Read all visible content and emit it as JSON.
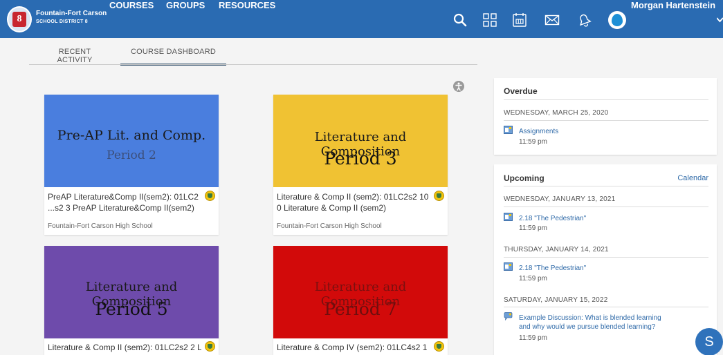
{
  "header": {
    "district_line1": "Fountain-Fort Carson",
    "district_line2": "SCHOOL DISTRICT 8",
    "logo_text": "8",
    "nav": [
      "COURSES",
      "GROUPS",
      "RESOURCES"
    ],
    "user_name": "Morgan Hartenstein",
    "icons": [
      "search-icon",
      "grid-icon",
      "calendar-icon",
      "mail-icon",
      "notifications-icon"
    ],
    "bg_color": "#2a6bb2"
  },
  "tabs": [
    {
      "label": "RECENT ACTIVITY",
      "active": false
    },
    {
      "label": "COURSE DASHBOARD",
      "active": true
    }
  ],
  "courses": [
    {
      "banner_line1": "Pre-AP Lit. and Comp.",
      "banner_line2": "Period 2",
      "banner_color": "#4a7ede",
      "title_line1": "PreAP Literature&Comp II(sem2): 01LC2",
      "title_line2": "...s2 3 PreAP Literature&Comp II(sem2)",
      "school": "Fountain-Fort Carson High School"
    },
    {
      "banner_line1": "Literature and Composition",
      "banner_line2": "Period 3",
      "banner_color": "#f0c233",
      "title_line1": "Literature & Comp II (sem2): 01LC2s2 10",
      "title_line2": "0 Literature & Comp II (sem2)",
      "school": "Fountain-Fort Carson High School"
    },
    {
      "banner_line1": "Literature and Composition",
      "banner_line2": "Period 5",
      "banner_color": "#6e4bab",
      "title_line1": "Literature & Comp II (sem2): 01LC2s2 2 L"
    },
    {
      "banner_line1": "Literature and Composition",
      "banner_line2": "Period 7",
      "banner_color": "#d20a0a",
      "title_line1": "Literature & Comp IV (sem2): 01LC4s2 1"
    }
  ],
  "overdue": {
    "title": "Overdue",
    "date": "WEDNESDAY, MARCH 25, 2020",
    "items": [
      {
        "title": "Assignments",
        "time": "11:59 pm"
      }
    ]
  },
  "upcoming": {
    "title": "Upcoming",
    "calendar_link": "Calendar",
    "groups": [
      {
        "date": "WEDNESDAY, JANUARY 13, 2021",
        "items": [
          {
            "title": "2.18 \"The Pedestrian\"",
            "time": "11:59 pm"
          }
        ]
      },
      {
        "date": "THURSDAY, JANUARY 14, 2021",
        "items": [
          {
            "title": "2.18 \"The Pedestrian\"",
            "time": "11:59 pm"
          }
        ]
      },
      {
        "date": "SATURDAY, JANUARY 15, 2022",
        "items": [
          {
            "title_line1": "Example Discussion: What is blended learning",
            "title_line2": "and why would we pursue blended learning?",
            "time": "11:59 pm"
          }
        ]
      }
    ]
  },
  "fab_label": "S"
}
